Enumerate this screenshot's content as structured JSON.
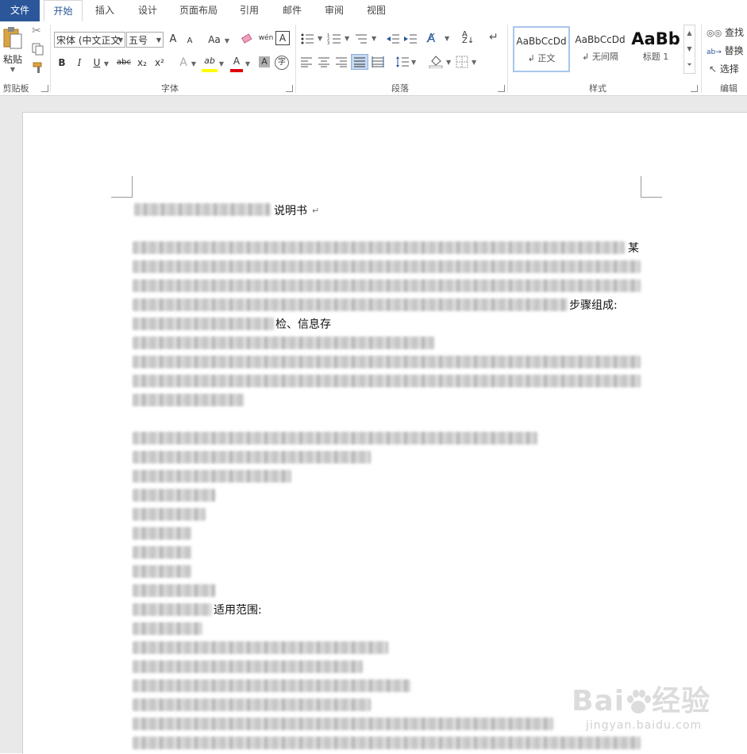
{
  "tabs": [
    {
      "label": "文件",
      "state": "file"
    },
    {
      "label": "开始",
      "state": "active"
    },
    {
      "label": "插入",
      "state": ""
    },
    {
      "label": "设计",
      "state": ""
    },
    {
      "label": "页面布局",
      "state": ""
    },
    {
      "label": "引用",
      "state": ""
    },
    {
      "label": "邮件",
      "state": ""
    },
    {
      "label": "审阅",
      "state": ""
    },
    {
      "label": "视图",
      "state": ""
    }
  ],
  "clipboard": {
    "paste_label": "粘贴",
    "group_label": "剪贴板"
  },
  "font": {
    "font_name": "宋体 (中文正文",
    "font_size": "五号",
    "grow": "A",
    "shrink": "A",
    "case": "Aa",
    "phonetic": "wén",
    "bold": "B",
    "italic": "I",
    "underline": "U",
    "strike": "abc",
    "subscript": "x₂",
    "superscript": "x²",
    "effects": "A",
    "highlight": "ab",
    "font_color": "A",
    "shading": "A",
    "enclose": "字",
    "border_char": "A",
    "group_label": "字体",
    "highlight_color": "#ffff00",
    "font_color_value": "#e00000"
  },
  "paragraph": {
    "group_label": "段落"
  },
  "styles": {
    "group_label": "样式",
    "items": [
      {
        "sample": "AaBbCcDd",
        "name": "↲ 正文"
      },
      {
        "sample": "AaBbCcDd",
        "name": "↲ 无间隔"
      },
      {
        "sample": "AaBb",
        "name": "标题 1"
      }
    ]
  },
  "editing": {
    "group_label": "编辑",
    "find": "查找",
    "replace": "替换",
    "select": "选择"
  },
  "document": {
    "title_suffix": "说明书",
    "fragment_1": "某",
    "fragment_2": "步骤组成:",
    "fragment_3": "检、信息存",
    "fragment_4": "适用范围:"
  },
  "watermark": {
    "logo": "Baidu经验",
    "url": "jingyan.baidu.com"
  },
  "colors": {
    "accent": "#2b579a",
    "page_bg": "#e9e9e9"
  }
}
